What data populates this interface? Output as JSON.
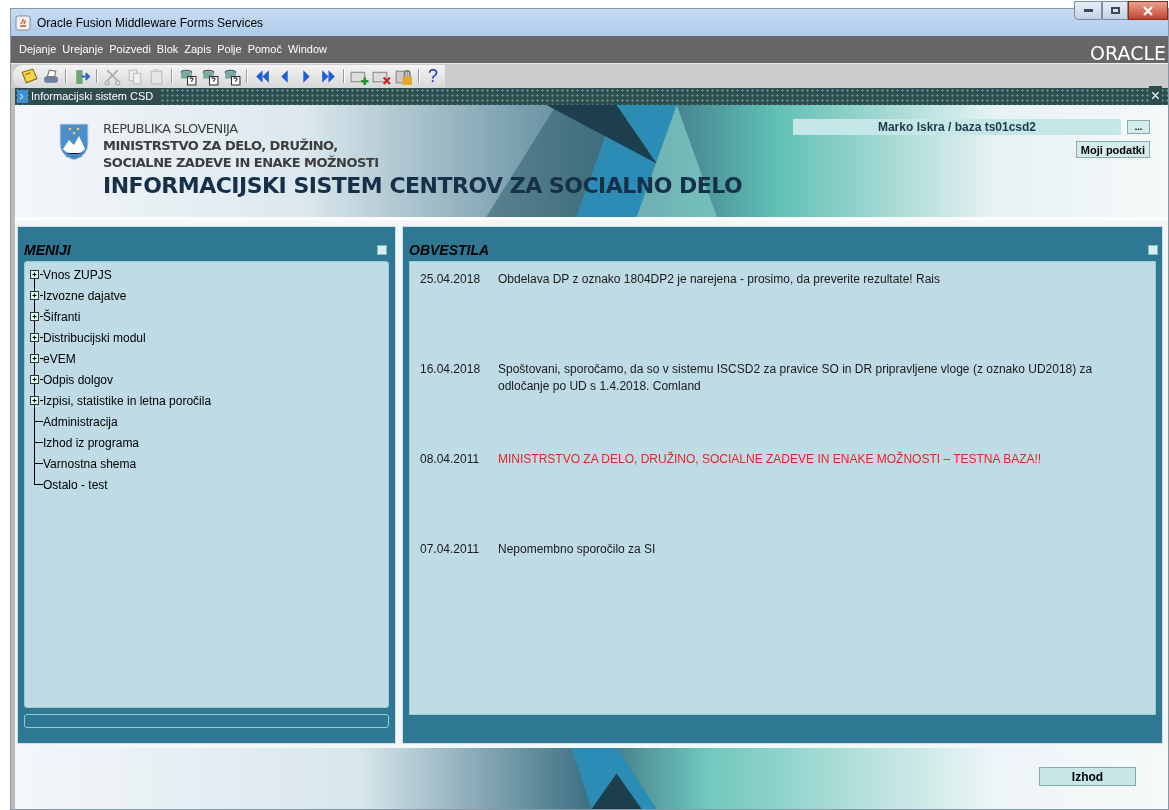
{
  "window": {
    "title": "Oracle Fusion Middleware Forms Services"
  },
  "menu": [
    "Dejanje",
    "Urejanje",
    "Poizvedi",
    "Blok",
    "Zapis",
    "Polje",
    "Pomoč",
    "Window"
  ],
  "brand": "ORACLE",
  "toolbar": [
    {
      "kind": "save"
    },
    {
      "kind": "print"
    },
    {
      "kind": "sep"
    },
    {
      "kind": "exit"
    },
    {
      "kind": "sep"
    },
    {
      "kind": "cut"
    },
    {
      "kind": "copy"
    },
    {
      "kind": "paste"
    },
    {
      "kind": "sep"
    },
    {
      "kind": "query"
    },
    {
      "kind": "query"
    },
    {
      "kind": "query"
    },
    {
      "kind": "sep"
    },
    {
      "kind": "first"
    },
    {
      "kind": "prev"
    },
    {
      "kind": "next"
    },
    {
      "kind": "last"
    },
    {
      "kind": "sep"
    },
    {
      "kind": "insert"
    },
    {
      "kind": "delete"
    },
    {
      "kind": "lock"
    },
    {
      "kind": "sep"
    },
    {
      "kind": "help",
      "text": "?"
    }
  ],
  "form": {
    "title": "Informacijski sistem CSD",
    "close": "×"
  },
  "header": {
    "lines": [
      "REPUBLIKA SLOVENIJA",
      "MINISTRSTVO ZA DELO, DRUŽINO,",
      "SOCIALNE ZADEVE IN ENAKE MOŽNOSTI"
    ],
    "system": "INFORMACIJSKI SISTEM CENTROV ZA SOCIALNO DELO",
    "user": "Marko Iskra / baza ts01csd2",
    "more_button": "...",
    "profile_button": "Moji podatki"
  },
  "menus": {
    "title": "MENIJI",
    "items": [
      {
        "label": "Vnos ZUPJS",
        "expandable": true
      },
      {
        "label": "Izvozne dajatve",
        "expandable": true
      },
      {
        "label": "Šifranti",
        "expandable": true
      },
      {
        "label": "Distribucijski modul",
        "expandable": true
      },
      {
        "label": "eVEM",
        "expandable": true
      },
      {
        "label": "Odpis dolgov",
        "expandable": true
      },
      {
        "label": "Izpisi, statistike in letna poročila",
        "expandable": true
      },
      {
        "label": "Administracija",
        "expandable": false
      },
      {
        "label": "Izhod iz programa",
        "expandable": false
      },
      {
        "label": "Varnostna shema",
        "expandable": false
      },
      {
        "label": "Ostalo - test",
        "expandable": false
      }
    ]
  },
  "notices": {
    "title": "OBVESTILA",
    "items": [
      {
        "date": "25.04.2018",
        "text": "Obdelava DP z oznako 1804DP2 je narejena - prosimo, da preverite rezultate! Rais",
        "important": false
      },
      {
        "date": "16.04.2018",
        "text": "Spoštovani, sporočamo, da so v sistemu ISCSD2 za pravice SO in DR pripravljene vloge (z oznako UD2018) za odločanje po UD s 1.4.2018. Comland",
        "important": false
      },
      {
        "date": "08.04.2011",
        "text": "MINISTRSTVO ZA DELO, DRUŽINO, SOCIALNE ZADEVE IN ENAKE MOŽNOSTI – TESTNA BAZA!!",
        "important": true
      },
      {
        "date": "07.04.2011",
        "text": "Nepomembno sporočilo za SI",
        "important": false
      }
    ]
  },
  "exit_button": "Izhod"
}
